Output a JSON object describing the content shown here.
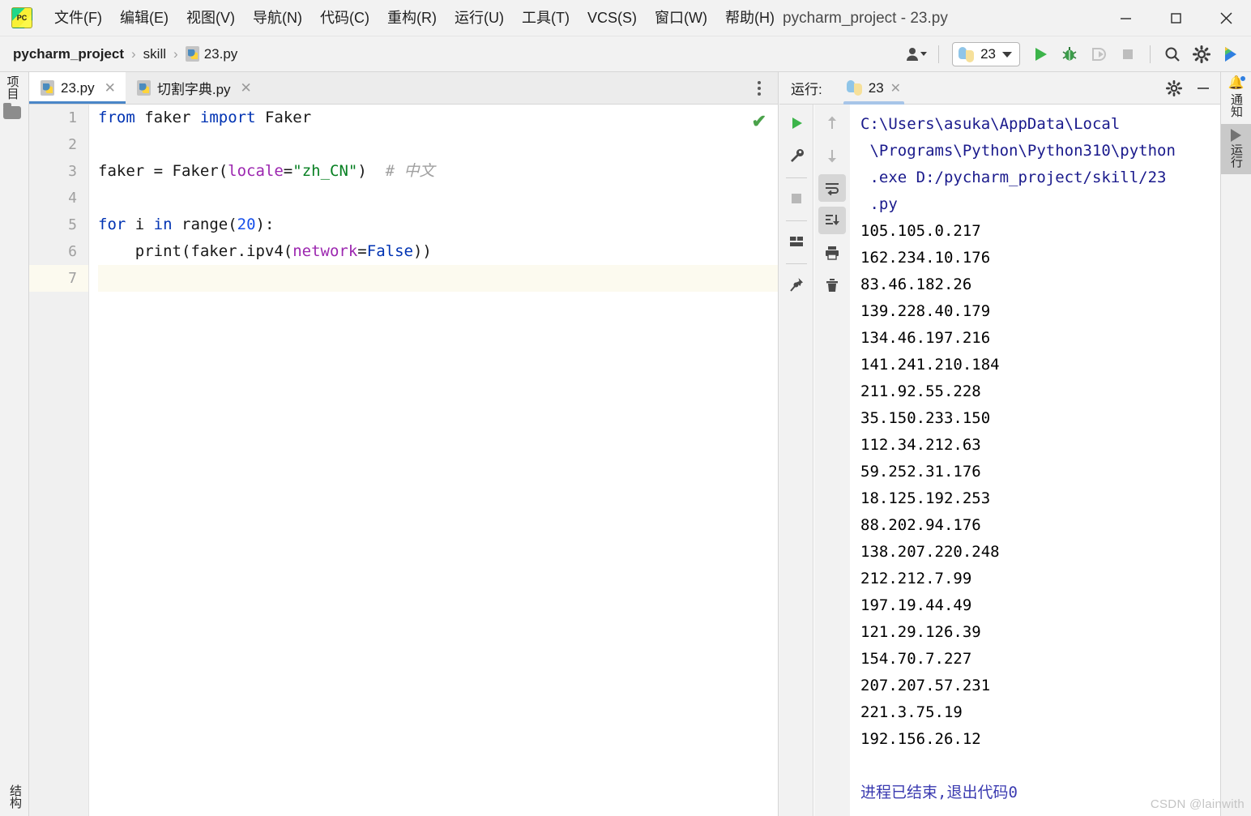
{
  "window": {
    "title": "pycharm_project - 23.py",
    "app_logo_text": "PC",
    "minimize": "—",
    "maximize": "☐",
    "close": "✕"
  },
  "menubar": {
    "items": [
      {
        "label": "文件(F)",
        "text": "文件",
        "mnemonic": "F"
      },
      {
        "label": "编辑(E)",
        "text": "编辑",
        "mnemonic": "E"
      },
      {
        "label": "视图(V)",
        "text": "视图",
        "mnemonic": "V"
      },
      {
        "label": "导航(N)",
        "text": "导航",
        "mnemonic": "N"
      },
      {
        "label": "代码(C)",
        "text": "代码",
        "mnemonic": "C"
      },
      {
        "label": "重构(R)",
        "text": "重构",
        "mnemonic": "R"
      },
      {
        "label": "运行(U)",
        "text": "运行",
        "mnemonic": "U"
      },
      {
        "label": "工具(T)",
        "text": "工具",
        "mnemonic": "T"
      },
      {
        "label": "VCS(S)",
        "text": "VCS",
        "mnemonic": "S"
      },
      {
        "label": "窗口(W)",
        "text": "窗口",
        "mnemonic": "W"
      },
      {
        "label": "帮助(H)",
        "text": "帮助",
        "mnemonic": "H"
      }
    ]
  },
  "breadcrumb": {
    "project": "pycharm_project",
    "folder": "skill",
    "file": "23.py",
    "separator": "›"
  },
  "toolbar": {
    "run_config_name": "23",
    "run_label": "运行",
    "debug_label": "调试",
    "coverage_label": "运行覆盖率",
    "stop_label": "停止",
    "search_label": "搜索",
    "settings_label": "设置",
    "account_label": "账户"
  },
  "left_stripe": {
    "project_label": "项目",
    "structure_label": "结构"
  },
  "editor": {
    "tabs": [
      {
        "label": "23.py",
        "active": true,
        "close": "✕"
      },
      {
        "label": "切割字典.py",
        "active": false,
        "close": "✕"
      }
    ],
    "more_label": "更多选项",
    "inspection_status": "✔",
    "line_numbers": [
      "1",
      "2",
      "3",
      "4",
      "5",
      "6",
      "7"
    ],
    "current_line": 7,
    "lines": [
      {
        "n": 1,
        "tokens": [
          {
            "t": "from",
            "c": "kw"
          },
          {
            "t": " ",
            "c": "plain"
          },
          {
            "t": "faker",
            "c": "plain"
          },
          {
            "t": " ",
            "c": "plain"
          },
          {
            "t": "import",
            "c": "kw"
          },
          {
            "t": " ",
            "c": "plain"
          },
          {
            "t": "Faker",
            "c": "plain"
          }
        ]
      },
      {
        "n": 2,
        "tokens": []
      },
      {
        "n": 3,
        "tokens": [
          {
            "t": "faker = Faker(",
            "c": "plain"
          },
          {
            "t": "locale",
            "c": "param"
          },
          {
            "t": "=",
            "c": "plain"
          },
          {
            "t": "\"zh_CN\"",
            "c": "str"
          },
          {
            "t": ")",
            "c": "plain"
          },
          {
            "t": "  # 中文",
            "c": "cmt"
          }
        ]
      },
      {
        "n": 4,
        "tokens": []
      },
      {
        "n": 5,
        "tokens": [
          {
            "t": "for",
            "c": "kw"
          },
          {
            "t": " i ",
            "c": "plain"
          },
          {
            "t": "in",
            "c": "kw"
          },
          {
            "t": " ",
            "c": "plain"
          },
          {
            "t": "range",
            "c": "plain"
          },
          {
            "t": "(",
            "c": "plain"
          },
          {
            "t": "20",
            "c": "num"
          },
          {
            "t": "):",
            "c": "plain"
          }
        ]
      },
      {
        "n": 6,
        "tokens": [
          {
            "t": "    print(faker.ipv4(",
            "c": "plain"
          },
          {
            "t": "network",
            "c": "param"
          },
          {
            "t": "=",
            "c": "plain"
          },
          {
            "t": "False",
            "c": "kw"
          },
          {
            "t": "))",
            "c": "plain"
          }
        ]
      },
      {
        "n": 7,
        "tokens": []
      }
    ]
  },
  "run_panel": {
    "header_label": "运行:",
    "tab_label": "23",
    "tab_close": "✕",
    "settings_label": "设置",
    "hide_label": "隐藏",
    "tools_left": [
      {
        "name": "rerun-icon",
        "glyph": "▶",
        "label": "重新运行",
        "active": false
      },
      {
        "name": "wrench-icon",
        "glyph": "🔧",
        "label": "修改运行配置",
        "active": false
      },
      {
        "name": "stop-icon",
        "glyph": "■",
        "label": "停止",
        "active": false
      },
      {
        "name": "layout-icon",
        "glyph": "▤",
        "label": "布局",
        "active": false
      },
      {
        "name": "pin-icon",
        "glyph": "📌",
        "label": "固定标签页",
        "active": false
      }
    ],
    "tools_right": [
      {
        "name": "arrow-up-icon",
        "glyph": "↑",
        "label": "上一个",
        "active": false
      },
      {
        "name": "arrow-down-icon",
        "glyph": "↓",
        "label": "下一个",
        "active": false
      },
      {
        "name": "soft-wrap-icon",
        "glyph": "↵",
        "label": "软换行",
        "active": true
      },
      {
        "name": "scroll-end-icon",
        "glyph": "↧",
        "label": "滚动到末尾",
        "active": true
      },
      {
        "name": "print-icon",
        "glyph": "🖨",
        "label": "打印",
        "active": false
      },
      {
        "name": "trash-icon",
        "glyph": "🗑",
        "label": "清空全部",
        "active": false
      }
    ],
    "console_lines": [
      {
        "text": "C:\\Users\\asuka\\AppData\\Local",
        "kind": "cmd"
      },
      {
        "text": " \\Programs\\Python\\Python310\\python",
        "kind": "cmd"
      },
      {
        "text": " .exe D:/pycharm_project/skill/23",
        "kind": "cmd"
      },
      {
        "text": " .py",
        "kind": "cmd"
      },
      {
        "text": "105.105.0.217",
        "kind": "out"
      },
      {
        "text": "162.234.10.176",
        "kind": "out"
      },
      {
        "text": "83.46.182.26",
        "kind": "out"
      },
      {
        "text": "139.228.40.179",
        "kind": "out"
      },
      {
        "text": "134.46.197.216",
        "kind": "out"
      },
      {
        "text": "141.241.210.184",
        "kind": "out"
      },
      {
        "text": "211.92.55.228",
        "kind": "out"
      },
      {
        "text": "35.150.233.150",
        "kind": "out"
      },
      {
        "text": "112.34.212.63",
        "kind": "out"
      },
      {
        "text": "59.252.31.176",
        "kind": "out"
      },
      {
        "text": "18.125.192.253",
        "kind": "out"
      },
      {
        "text": "88.202.94.176",
        "kind": "out"
      },
      {
        "text": "138.207.220.248",
        "kind": "out"
      },
      {
        "text": "212.212.7.99",
        "kind": "out"
      },
      {
        "text": "197.19.44.49",
        "kind": "out"
      },
      {
        "text": "121.29.126.39",
        "kind": "out"
      },
      {
        "text": "154.70.7.227",
        "kind": "out"
      },
      {
        "text": "207.207.57.231",
        "kind": "out"
      },
      {
        "text": "221.3.75.19",
        "kind": "out"
      },
      {
        "text": "192.156.26.12",
        "kind": "out"
      },
      {
        "text": "",
        "kind": "out"
      },
      {
        "text": "进程已结束,退出代码0",
        "kind": "exit"
      }
    ]
  },
  "right_stripe": {
    "notifications_label": "通知",
    "run_label": "运行"
  },
  "watermark": {
    "text": "CSDN @lainwith"
  },
  "colors": {
    "accent_blue": "#4a86c8",
    "keyword": "#0033b3",
    "string": "#078022",
    "param": "#9c27b0",
    "number": "#1750eb",
    "comment": "#a0a0a0",
    "console_cmd": "#1a1a8c",
    "console_exit": "#3a3ab0",
    "ok_green": "#4aa24a",
    "titlebar_bg": "#f2f2f2",
    "editor_bg": "#ffffff",
    "current_line_bg": "#fcfaef"
  }
}
